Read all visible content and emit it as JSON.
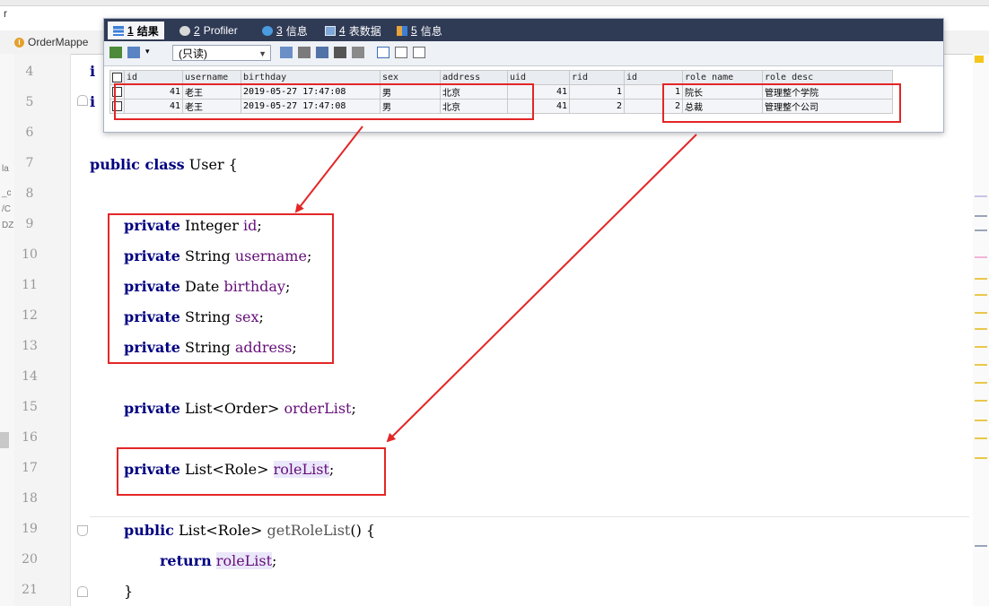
{
  "window": {
    "top_letter": "r",
    "left_strip_text": [
      "la",
      "_c",
      "/C",
      "DZ"
    ]
  },
  "editor_tab": {
    "icon": "java-class-icon",
    "label": "OrderMappe"
  },
  "result_window": {
    "tabs": [
      {
        "num": "1",
        "label": "结果",
        "icon": "table-icon"
      },
      {
        "num": "2",
        "label": "Profiler",
        "icon": "profiler-icon"
      },
      {
        "num": "3",
        "label": "信息",
        "icon": "info-icon"
      },
      {
        "num": "4",
        "label": "表数据",
        "icon": "table-data-icon"
      },
      {
        "num": "5",
        "label": "信息",
        "icon": "info2-icon"
      }
    ],
    "readonly_select": "(只读)",
    "columns": [
      "id",
      "username",
      "birthday",
      "sex",
      "address",
      "uid",
      "rid",
      "id",
      "role name",
      "role desc"
    ],
    "rows": [
      [
        "41",
        "老王",
        "2019-05-27 17:47:08",
        "男",
        "北京",
        "41",
        "1",
        "1",
        "院长",
        "管理整个学院"
      ],
      [
        "41",
        "老王",
        "2019-05-27 17:47:08",
        "男",
        "北京",
        "41",
        "2",
        "2",
        "总裁",
        "管理整个公司"
      ]
    ]
  },
  "code": {
    "line_numbers": [
      "4",
      "5",
      "6",
      "7",
      "8",
      "9",
      "10",
      "11",
      "12",
      "13",
      "14",
      "15",
      "16",
      "17",
      "18",
      "19",
      "20",
      "21"
    ],
    "line4_partial": "i",
    "line5_partial": "i",
    "line7": {
      "kw": "public class",
      "rest": " User {"
    },
    "fields": [
      {
        "kw": "private",
        "type": " Integer ",
        "name": "id",
        "end": ";"
      },
      {
        "kw": "private",
        "type": " String ",
        "name": "username",
        "end": ";"
      },
      {
        "kw": "private",
        "type": " Date ",
        "name": "birthday",
        "end": ";"
      },
      {
        "kw": "private",
        "type": " String ",
        "name": "sex",
        "end": ";"
      },
      {
        "kw": "private",
        "type": " String ",
        "name": "address",
        "end": ";"
      }
    ],
    "line15": {
      "kw": "private",
      "type": " List<Order> ",
      "name": "orderList",
      "end": ";"
    },
    "line17": {
      "kw": "private",
      "type": " List<Role> ",
      "name": "roleList",
      "end": ";"
    },
    "line19": {
      "kw": "public",
      "type": " List<Role> ",
      "method": "getRoleList",
      "end": "() {"
    },
    "line20": {
      "kw": "return",
      "name": "roleList",
      "end": ";"
    },
    "line21": "}"
  },
  "colors": {
    "annotation_red": "#e32626",
    "keyword_blue": "#000080",
    "field_purple": "#660e7a"
  }
}
